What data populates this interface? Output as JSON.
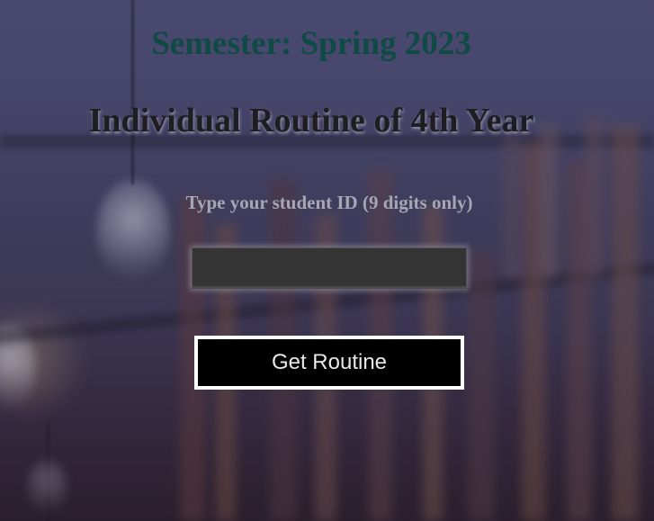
{
  "header": {
    "semester": "Semester: Spring 2023",
    "title": "Individual Routine of 4th Year"
  },
  "form": {
    "prompt": "Type your student ID (9 digits only)",
    "student_id_value": "",
    "student_id_placeholder": "",
    "submit_label": "Get Routine"
  },
  "colors": {
    "semester_text": "#0f4a45",
    "title_text": "#1d1d22",
    "prompt_text": "#a6a6b5",
    "input_background": "#343434",
    "button_background": "#000000",
    "button_border": "#ffffff"
  }
}
